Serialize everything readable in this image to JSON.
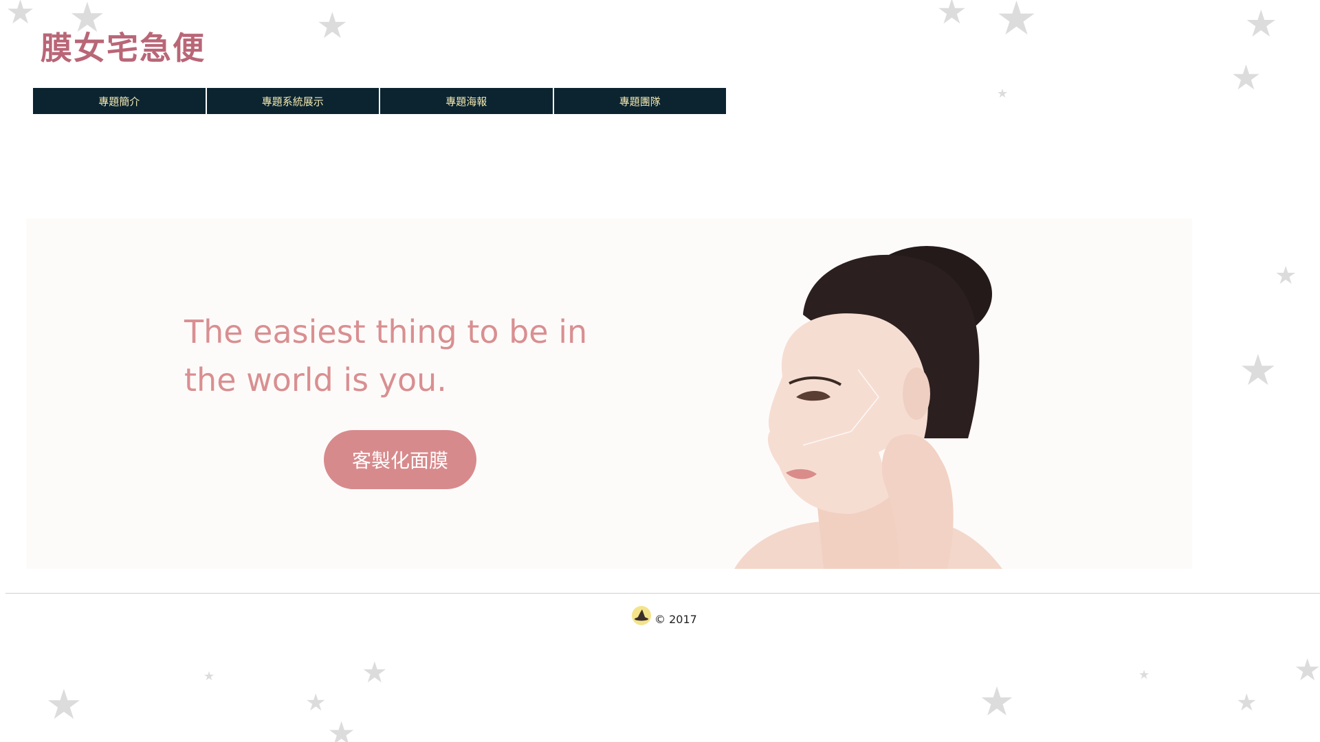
{
  "site": {
    "title": "膜女宅急便"
  },
  "nav": {
    "items": [
      {
        "label": "專題簡介"
      },
      {
        "label": "專題系統展示"
      },
      {
        "label": "專題海報"
      },
      {
        "label": "專題團隊"
      }
    ]
  },
  "hero": {
    "tagline": "The easiest thing to be in the world is you.",
    "cta_label": "客製化面膜",
    "image_subject": "woman-peeling-face-mask"
  },
  "footer": {
    "copyright": "© 2017",
    "logo_icon": "witch-hat-icon"
  },
  "colors": {
    "title": "#b96677",
    "nav_background": "#0b2430",
    "nav_text": "#f3e8b0",
    "accent": "#d78a8c",
    "tagline": "#d98f91",
    "star": "#dcdcdc"
  }
}
